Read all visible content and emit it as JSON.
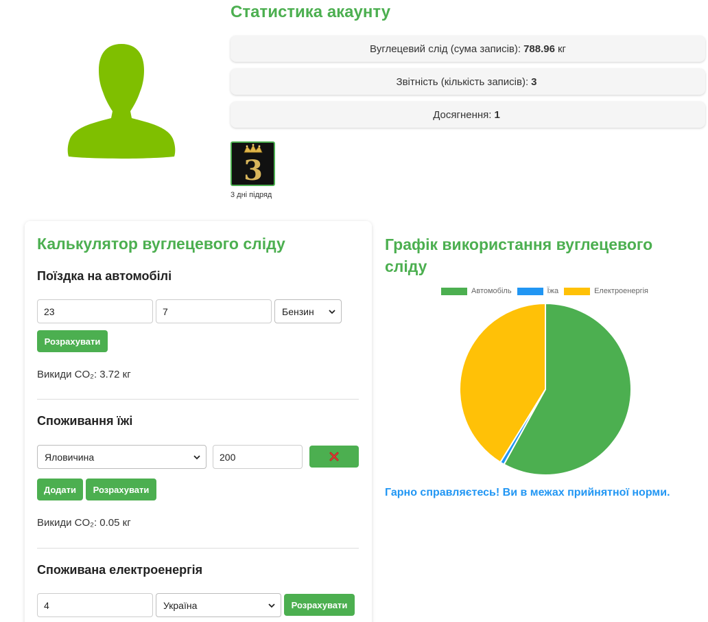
{
  "profile": {
    "avatar_icon": "user-silhouette-icon",
    "avatar_color": "#7fbf00"
  },
  "stats": {
    "title": "Статистика акаунту",
    "footprint_label": "Вуглецевий слід (сума записів):",
    "footprint_value": "788.96",
    "footprint_unit": "кг",
    "records_label": "Звітність (кількість записів):",
    "records_value": "3",
    "achievements_label": "Досягнення:",
    "achievements_value": "1",
    "badge_number": "3",
    "badge_icon": "crown-icon",
    "badge_caption": "3 дні підряд"
  },
  "calculator": {
    "title": "Калькулятор вуглецевого сліду",
    "car": {
      "title": "Поїздка на автомобілі",
      "distance_value": "23",
      "consumption_value": "7",
      "fuel_selected": "Бензин",
      "calculate_label": "Розрахувати",
      "result": "Викиди CO₂: 3.72 кг"
    },
    "food": {
      "title": "Споживання їжі",
      "food_selected": "Яловичина",
      "amount_value": "200",
      "remove_icon": "close-icon",
      "add_label": "Додати",
      "calculate_label": "Розрахувати",
      "result": "Викиди CO₂: 0.05 кг"
    },
    "electricity": {
      "title": "Спожи­вана електроенергія",
      "kwh_value": "4",
      "country_selected": "Україна",
      "calculate_label": "Розрахувати"
    }
  },
  "chart_section": {
    "title": "Графік використання вуглецевого сліду",
    "feedback": "Гарно справляєтесь! Ви в межах прийнятної норми."
  },
  "chart_data": {
    "type": "pie",
    "categories": [
      "Автомобіль",
      "Їжа",
      "Електроенергія"
    ],
    "values": [
      3.72,
      0.05,
      2.64
    ],
    "colors": [
      "#4caf50",
      "#2196f3",
      "#ffc107"
    ],
    "legend": "top"
  }
}
